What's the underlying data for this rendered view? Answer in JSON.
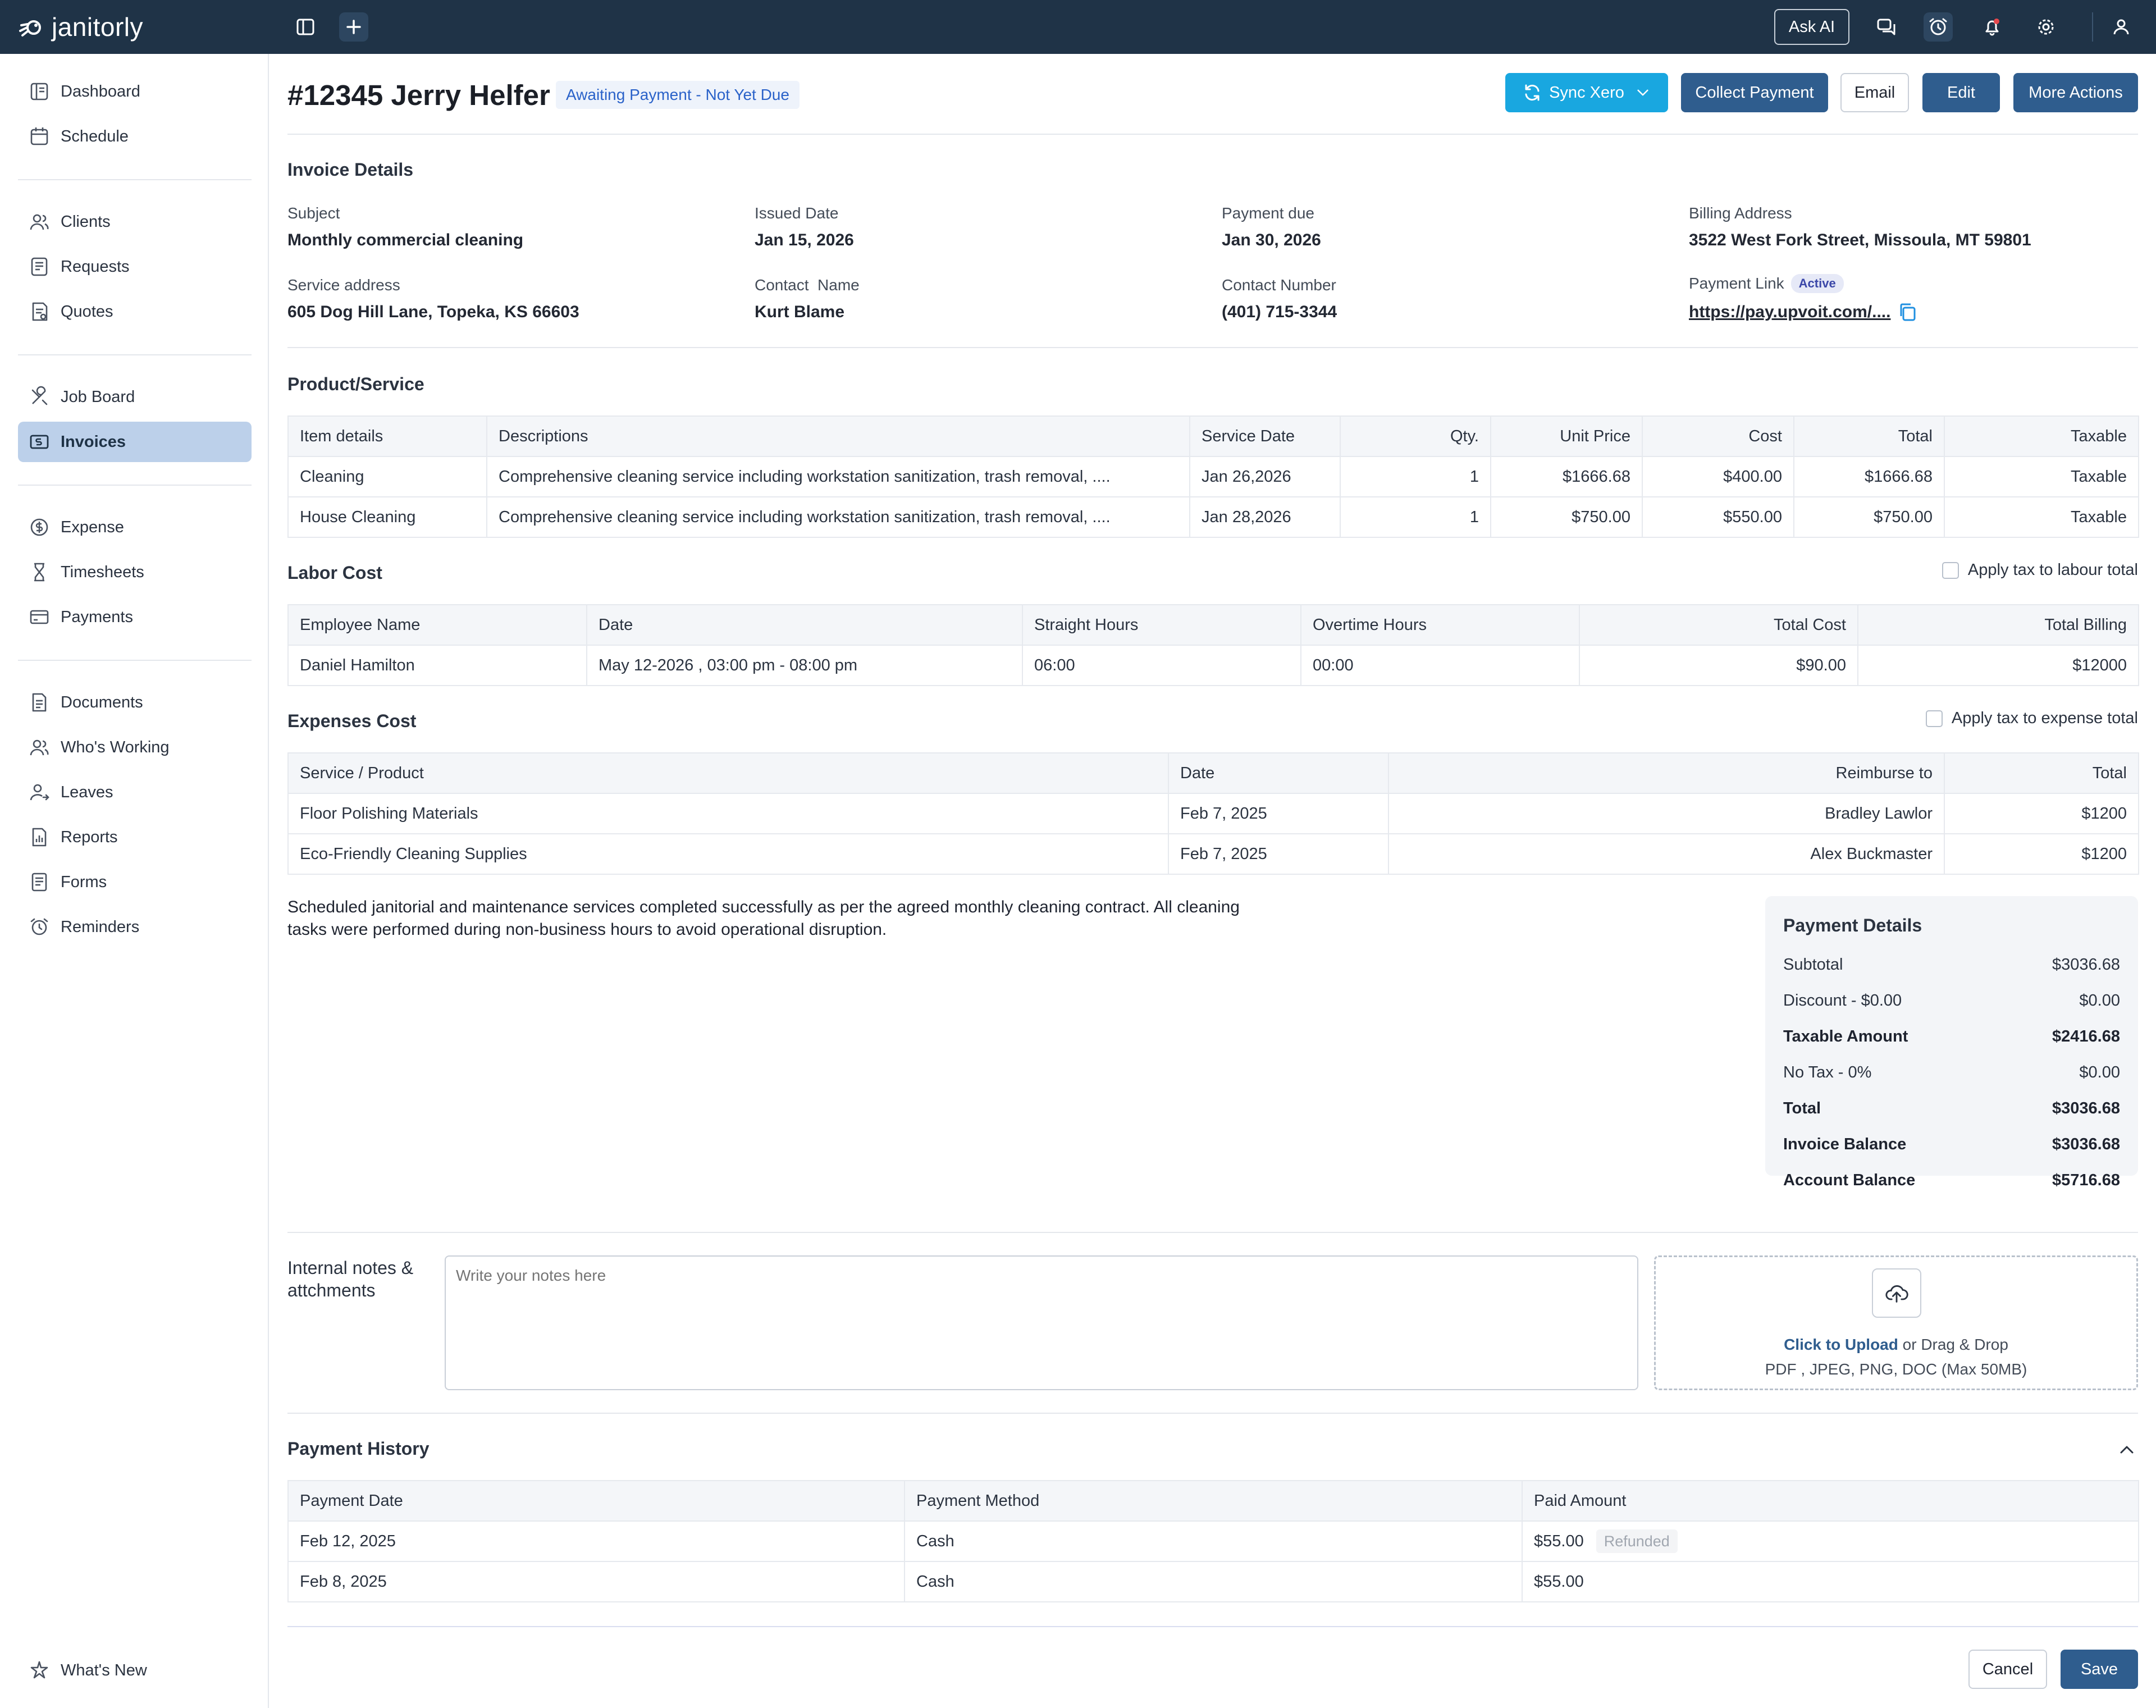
{
  "app": {
    "logo_text": "janitorly"
  },
  "topbar": {
    "ask_ai": "Ask AI"
  },
  "sidebar": {
    "items": [
      {
        "label": "Dashboard"
      },
      {
        "label": "Schedule"
      },
      {
        "label": "Clients"
      },
      {
        "label": "Requests"
      },
      {
        "label": "Quotes"
      },
      {
        "label": "Job Board"
      },
      {
        "label": "Invoices"
      },
      {
        "label": "Expense"
      },
      {
        "label": "Timesheets"
      },
      {
        "label": "Payments"
      },
      {
        "label": "Documents"
      },
      {
        "label": "Who's Working"
      },
      {
        "label": "Leaves"
      },
      {
        "label": "Reports"
      },
      {
        "label": "Forms"
      },
      {
        "label": "Reminders"
      }
    ],
    "whats_new": "What's New"
  },
  "header": {
    "title": "#12345 Jerry Helfer",
    "status": "Awaiting Payment - Not Yet Due",
    "buttons": {
      "sync": "Sync Xero",
      "collect": "Collect Payment",
      "email": "Email",
      "edit": "Edit",
      "more": "More Actions"
    }
  },
  "invoice_details": {
    "title": "Invoice Details",
    "subject_label": "Subject",
    "subject": "Monthly commercial cleaning",
    "issued_label": "Issued Date",
    "issued": "Jan 15, 2026",
    "due_label": "Payment due",
    "due": "Jan 30, 2026",
    "billing_label": "Billing Address",
    "billing": "3522 West Fork Street, Missoula, MT 59801",
    "service_label": "Service address",
    "service": "605 Dog Hill Lane, Topeka, KS 66603",
    "contact_name_label": "Contact  Name",
    "contact_name": "Kurt Blame",
    "contact_number_label": "Contact Number",
    "contact_number": "(401) 715-3344",
    "payment_link_label": "Payment Link",
    "payment_link_status": "Active",
    "payment_link": "https://pay.upvoit.com/...."
  },
  "products": {
    "title": "Product/Service",
    "headers": [
      "Item details",
      "Descriptions",
      "Service Date",
      "Qty.",
      "Unit Price",
      "Cost",
      "Total",
      "Taxable"
    ],
    "rows": [
      [
        "Cleaning",
        "Comprehensive cleaning service including workstation sanitization, trash removal, ....",
        "Jan 26,2026",
        "1",
        "$1666.68",
        "$400.00",
        "$1666.68",
        "Taxable"
      ],
      [
        "House Cleaning",
        "Comprehensive cleaning service including workstation sanitization, trash removal, ....",
        "Jan 28,2026",
        "1",
        "$750.00",
        "$550.00",
        "$750.00",
        "Taxable"
      ]
    ]
  },
  "labor": {
    "title": "Labor Cost",
    "apply_tax": "Apply tax to labour total",
    "headers": [
      "Employee Name",
      "Date",
      "Straight Hours",
      "Overtime Hours",
      "Total Cost",
      "Total Billing"
    ],
    "rows": [
      [
        "Daniel Hamilton",
        "May 12-2026 , 03:00 pm - 08:00 pm",
        "06:00",
        "00:00",
        "$90.00",
        "$12000"
      ]
    ]
  },
  "expenses": {
    "title": "Expenses Cost",
    "apply_tax": "Apply tax to expense total",
    "headers": [
      "Service / Product",
      "Date",
      "Reimburse to",
      "Total"
    ],
    "rows": [
      [
        "Floor Polishing Materials",
        "Feb 7, 2025",
        "Bradley Lawlor",
        "$1200"
      ],
      [
        "Eco-Friendly Cleaning Supplies",
        "Feb 7, 2025",
        "Alex Buckmaster",
        "$1200"
      ]
    ]
  },
  "message": "Scheduled janitorial and maintenance services completed successfully as per the agreed monthly cleaning contract. All cleaning tasks were performed during non-business hours to avoid operational disruption.",
  "payment_details": {
    "title": "Payment Details",
    "rows": [
      {
        "label": "Subtotal",
        "value": "$3036.68"
      },
      {
        "label": "Discount - $0.00",
        "value": "$0.00"
      },
      {
        "label": "Taxable Amount",
        "value": "$2416.68"
      },
      {
        "label": "No Tax - 0%",
        "value": "$0.00"
      },
      {
        "label": "Total",
        "value": "$3036.68"
      },
      {
        "label": "Invoice Balance",
        "value": "$3036.68"
      },
      {
        "label": "Account Balance",
        "value": "$5716.68"
      }
    ]
  },
  "notes": {
    "label": "Internal notes & attchments",
    "placeholder": "Write your notes here",
    "upload_link": "Click to Upload",
    "upload_rest": " or Drag & Drop",
    "upload_hint": "PDF , JPEG, PNG, DOC (Max 50MB)"
  },
  "history": {
    "title": "Payment History",
    "headers": [
      "Payment Date",
      "Payment Method",
      "Paid Amount"
    ],
    "rows": [
      {
        "date": "Feb 12, 2025",
        "method": "Cash",
        "amount": "$55.00",
        "badge": "Refunded"
      },
      {
        "date": "Feb 8, 2025",
        "method": "Cash",
        "amount": "$55.00"
      }
    ]
  },
  "footer": {
    "cancel": "Cancel",
    "save": "Save"
  }
}
